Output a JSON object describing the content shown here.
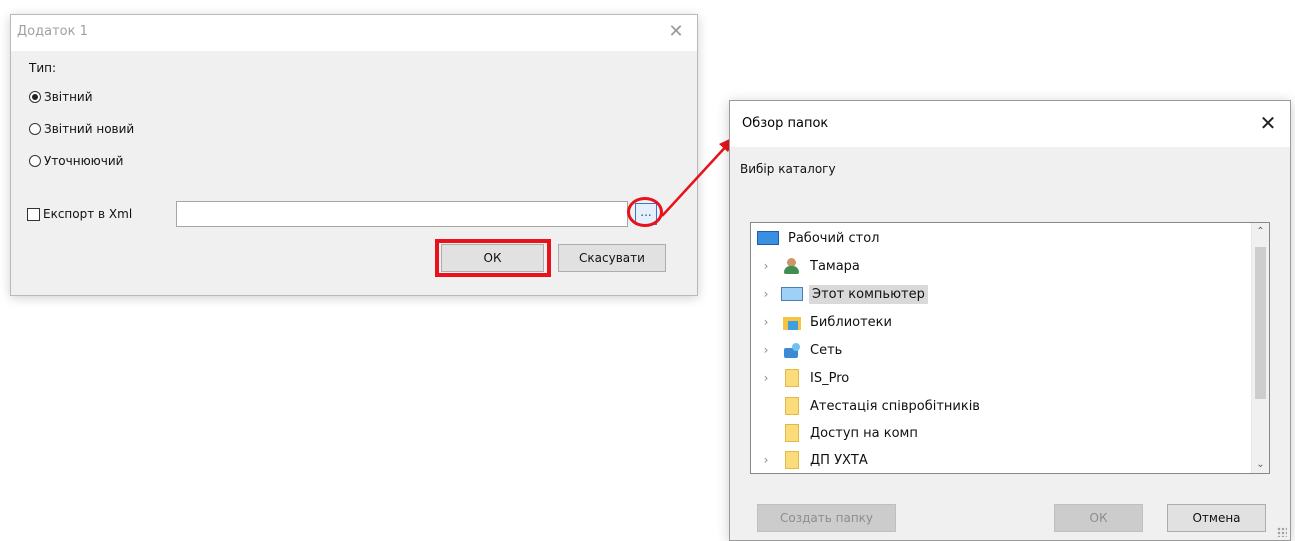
{
  "dialog1": {
    "title": "Додаток 1",
    "close_glyph": "✕",
    "type_label": "Тип:",
    "radios": [
      {
        "label": "Звітний",
        "checked": true
      },
      {
        "label": "Звітний новий",
        "checked": false
      },
      {
        "label": "Уточнюючий",
        "checked": false
      }
    ],
    "export_label": "Експорт в Xml",
    "export_checked": false,
    "path_value": "",
    "browse_label": "...",
    "ok_label": "ОК",
    "cancel_label": "Скасувати",
    "highlight_color": "#e8121a"
  },
  "dialog2": {
    "title": "Обзор папок",
    "close_glyph": "✕",
    "description": "Вибір каталогу",
    "tree": [
      {
        "label": "Рабочий стол",
        "icon": "desktop-icon",
        "expandable": false,
        "selected": false
      },
      {
        "label": "Тамара",
        "icon": "user-icon",
        "expandable": true,
        "selected": false
      },
      {
        "label": "Этот компьютер",
        "icon": "computer-icon",
        "expandable": true,
        "selected": true
      },
      {
        "label": "Библиотеки",
        "icon": "libraries-icon",
        "expandable": true,
        "selected": false
      },
      {
        "label": "Сеть",
        "icon": "network-icon",
        "expandable": true,
        "selected": false
      },
      {
        "label": "IS_Pro",
        "icon": "folder-icon",
        "expandable": true,
        "selected": false
      },
      {
        "label": "Атестація співробітників",
        "icon": "folder-icon",
        "expandable": false,
        "selected": false
      },
      {
        "label": "Доступ на комп",
        "icon": "folder-icon",
        "expandable": false,
        "selected": false
      },
      {
        "label": "ДП УХТА",
        "icon": "folder-icon",
        "expandable": true,
        "selected": false
      }
    ],
    "new_folder_label": "Создать папку",
    "ok_label": "ОК",
    "cancel_label": "Отмена"
  }
}
